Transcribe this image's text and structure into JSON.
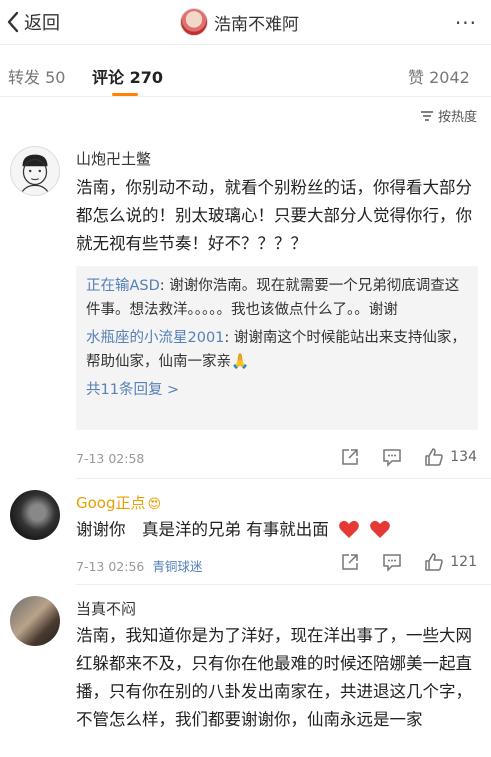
{
  "header": {
    "back_label": "返回",
    "title": "浩南不难阿",
    "more": "···"
  },
  "tabs": [
    {
      "label": "转发",
      "count": "50"
    },
    {
      "label": "评论",
      "count": "270"
    },
    {
      "label": "赞",
      "count": "2042"
    }
  ],
  "sort_label": "按热度",
  "comments": [
    {
      "name": "山炮卍土鳖",
      "text": "浩南，你别动不动，就看个别粉丝的话，你得看大部分都怎么说的！别太玻璃心！只要大部分人觉得你行，你就无视有些节奏！好不？？？？",
      "replies": [
        {
          "name": "正在输ASD",
          "text": ": 谢谢你浩南。现在就需要一个兄弟彻底调查这件事。想法救洋。。。。。我也该做点什么了。。谢谢"
        },
        {
          "name": "水瓶座的小流星2001",
          "text": ": 谢谢南这个时候能站出来支持仙家，帮助仙家，仙南一家亲🙏"
        }
      ],
      "more_replies": "共11条回复 >",
      "time": "7-13 02:58",
      "likes": "134"
    },
    {
      "name": "Goog正点",
      "name_emoji": "😍",
      "text": "谢谢你　真是洋的兄弟 有事就出面",
      "time": "7-13 02:56",
      "badge": "青铜球迷",
      "likes": "121"
    },
    {
      "name": "当真不闷",
      "text": "浩南，我知道你是为了洋好，现在洋出事了，一些大网红躲都来不及，只有你在他最难的时候还陪娜美一起直播，只有你在别的八卦发出南家在，共进退这几个字，不管怎么样，我们都要谢谢你，仙南永远是一家"
    }
  ]
}
